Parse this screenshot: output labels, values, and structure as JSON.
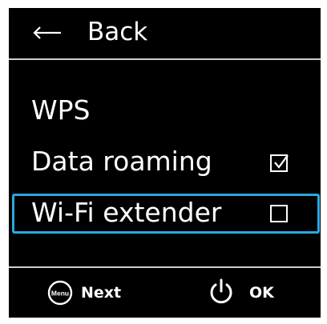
{
  "header": {
    "back_label": "Back",
    "back_icon": "back-arrow-icon"
  },
  "menu": {
    "items": [
      {
        "label": "WPS"
      },
      {
        "label": "Data roaming",
        "checked": true
      },
      {
        "label": "Wi-Fi extender",
        "checked": false,
        "focused": true
      }
    ]
  },
  "footer": {
    "next": {
      "icon_text": "Menu",
      "label": "Next"
    },
    "ok": {
      "icon": "power-icon",
      "label": "OK"
    }
  },
  "colors": {
    "screen_background": "#000000",
    "text": "#ffffff",
    "focus_border": "#2aa8e0",
    "divider": "#cfcfcf"
  }
}
